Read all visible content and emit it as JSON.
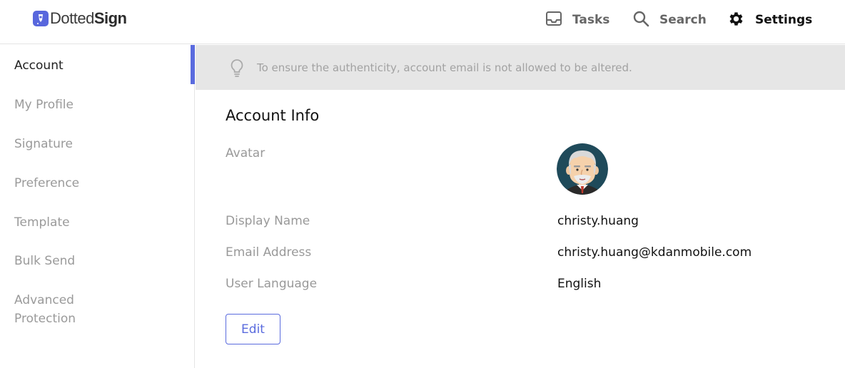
{
  "app": {
    "logo_light": "Dotted",
    "logo_bold": "Sign"
  },
  "nav": {
    "tasks": "Tasks",
    "search": "Search",
    "settings": "Settings",
    "active": "settings"
  },
  "sidebar": {
    "items": [
      {
        "label": "Account",
        "active": true
      },
      {
        "label": "My Profile",
        "active": false
      },
      {
        "label": "Signature",
        "active": false
      },
      {
        "label": "Preference",
        "active": false
      },
      {
        "label": "Template",
        "active": false
      },
      {
        "label": "Bulk Send",
        "active": false
      },
      {
        "label": "Advanced Protection",
        "active": false
      }
    ]
  },
  "banner": {
    "text": "To ensure the authenticity, account email is not allowed to be altered."
  },
  "account_info": {
    "title": "Account Info",
    "avatar_label": "Avatar",
    "display_name_label": "Display Name",
    "display_name": "christy.huang",
    "email_label": "Email Address",
    "email": "christy.huang@kdanmobile.com",
    "language_label": "User Language",
    "language": "English",
    "edit_label": "Edit"
  },
  "colors": {
    "accent": "#5a6bde",
    "banner_bg": "#e6e6e6",
    "muted_text": "#999999",
    "avatar_bg": "#1f4a5a"
  },
  "icons": {
    "tasks": "inbox-tray-icon",
    "search": "magnifier-icon",
    "settings": "gear-icon",
    "banner": "lightbulb-icon",
    "avatar": "user-avatar-illustration"
  }
}
